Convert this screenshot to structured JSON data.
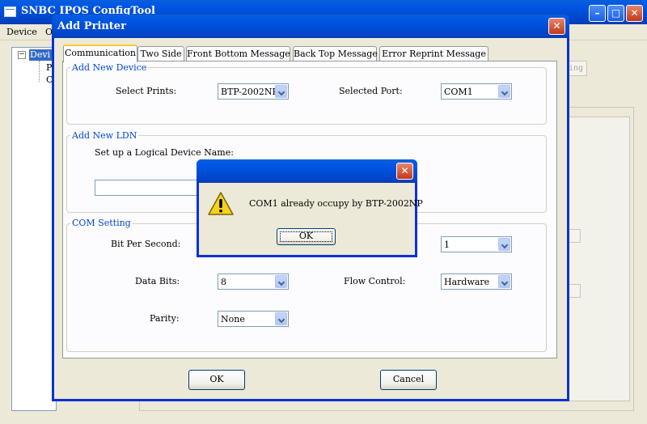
{
  "main_window": {
    "title": "SNBC IPOS ConfigTool",
    "buttons": {
      "minimize": "–",
      "maximize": "□",
      "close": "✕"
    },
    "menu": [
      "Device",
      "Op"
    ],
    "tree": {
      "root": "Devi",
      "children": [
        "P",
        "C"
      ]
    },
    "partial_button": "ing"
  },
  "dialog": {
    "title": "Add Printer",
    "tabs": [
      "Communication",
      "Two Side",
      "Front Bottom Message",
      "Back Top Message",
      "Error Reprint Message"
    ],
    "new_device": {
      "legend": "Add New Device",
      "select_prints_label": "Select Prints:",
      "select_prints_value": "BTP-2002NP",
      "selected_port_label": "Selected Port:",
      "selected_port_value": "COM1"
    },
    "new_ldn": {
      "legend": "Add New LDN",
      "prompt": "Set up a Logical Device Name:",
      "value": ""
    },
    "com_setting": {
      "legend": "COM Setting",
      "bit_per_second_label": "Bit Per Second:",
      "stop_bits_value": "1",
      "data_bits_label": "Data Bits:",
      "data_bits_value": "8",
      "flow_control_label": "Flow Control:",
      "flow_control_value": "Hardware",
      "parity_label": "Parity:",
      "parity_value": "None"
    },
    "ok_label": "OK",
    "cancel_label": "Cancel"
  },
  "message_box": {
    "text": "COM1 already occupy by BTP-2002NP",
    "ok_label": "OK"
  },
  "colors": {
    "title_bar": "#0058e6",
    "close_button": "#c2391b",
    "group_legend": "#0046d5",
    "window_face": "#ece9d8"
  }
}
